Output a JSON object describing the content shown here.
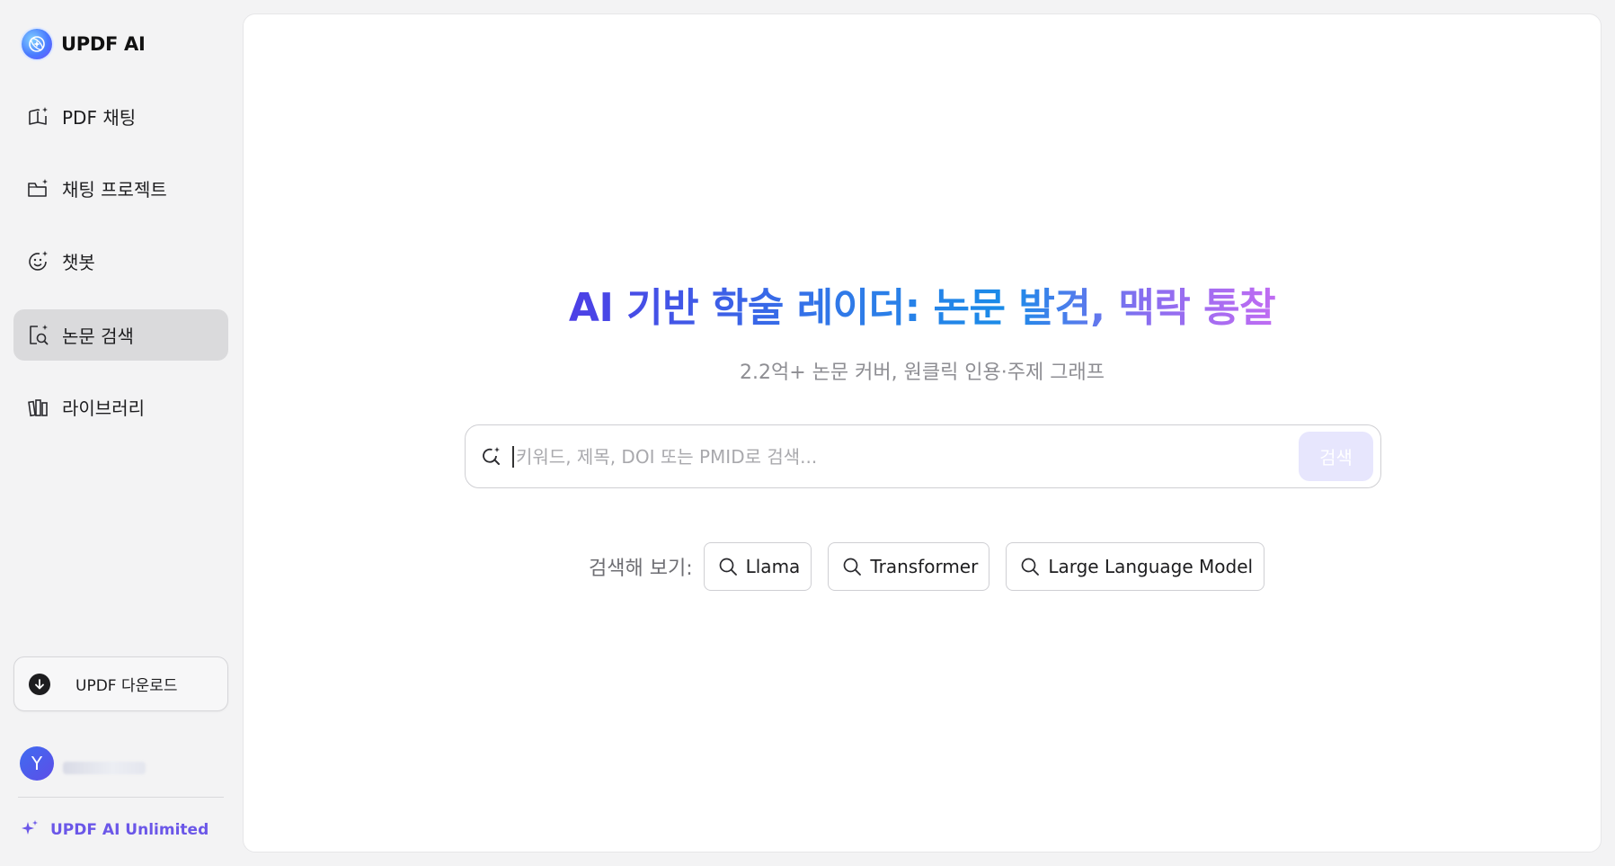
{
  "brand": {
    "title": "UPDF AI"
  },
  "sidebar": {
    "items": [
      {
        "label": "PDF 채팅",
        "icon": "book-sparkle-icon"
      },
      {
        "label": "채팅 프로젝트",
        "icon": "folder-sparkle-icon"
      },
      {
        "label": "챗봇",
        "icon": "chatbot-face-icon"
      },
      {
        "label": "논문 검색",
        "icon": "document-search-icon",
        "active": true
      },
      {
        "label": "라이브러리",
        "icon": "library-books-icon"
      }
    ],
    "download_label": "UPDF 다운로드",
    "user": {
      "initial": "Y"
    },
    "unlimited_label": "UPDF AI Unlimited"
  },
  "main": {
    "title": "AI 기반 학술 레이더: 논문 발견, 맥락 통찰",
    "subtitle": "2.2억+ 논문 커버, 원클릭 인용·주제 그래프",
    "search": {
      "placeholder": "키워드, 제목, DOI 또는 PMID로 검색...",
      "value": "",
      "button_label": "검색"
    },
    "suggestions": {
      "label": "검색해 보기:",
      "chips": [
        "Llama",
        "Transformer",
        "Large Language Model"
      ]
    }
  },
  "colors": {
    "accent": "#6b57e8",
    "active_nav_bg": "#dadadc",
    "search_button_bg": "#e7e6fd",
    "title_gradient": [
      "#4d3fe6",
      "#2f7be8",
      "#1a8be8",
      "#8a6df0",
      "#c06cf2"
    ]
  }
}
